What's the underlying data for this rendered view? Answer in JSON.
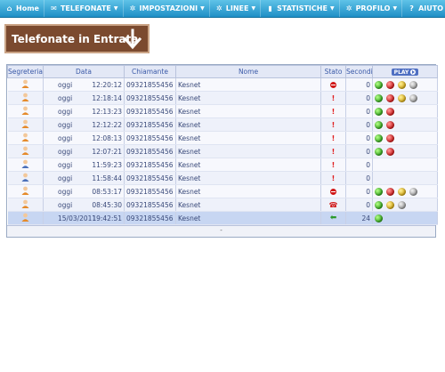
{
  "menu": [
    {
      "label": "Home",
      "icon": "home-icon",
      "glyph": "⌂",
      "has_caret": false
    },
    {
      "label": "TELEFONATE",
      "icon": "chat-icon",
      "glyph": "✉",
      "has_caret": true
    },
    {
      "label": "IMPOSTAZIONI",
      "icon": "gear-icon",
      "glyph": "✲",
      "has_caret": true
    },
    {
      "label": "LINEE",
      "icon": "gear-icon",
      "glyph": "✲",
      "has_caret": true
    },
    {
      "label": "STATISTICHE",
      "icon": "chart-icon",
      "glyph": "▮",
      "has_caret": true
    },
    {
      "label": "PROFILO",
      "icon": "gear-icon",
      "glyph": "✲",
      "has_caret": true
    },
    {
      "label": "AIUTO",
      "icon": "help-icon",
      "glyph": "?",
      "has_caret": true
    }
  ],
  "banner": {
    "title": "Telefonate in Entrata",
    "icon": "down-arrow-icon"
  },
  "table": {
    "headers": {
      "segreteria": "Segreteria",
      "data": "Data",
      "chiamante": "Chiamante",
      "nome": "Nome",
      "stato": "Stato",
      "secondi": "Secondi",
      "play": "PLAY"
    },
    "rows": [
      {
        "day": "oggi",
        "time": "12:20:12",
        "caller": "09321855456",
        "name": "Kesnet",
        "status": "blocked",
        "seconds": "0",
        "lights": [
          "green",
          "red",
          "yellow",
          "grey"
        ],
        "avatar": "orange"
      },
      {
        "day": "oggi",
        "time": "12:18:14",
        "caller": "09321855456",
        "name": "Kesnet",
        "status": "missed",
        "seconds": "0",
        "lights": [
          "green",
          "red",
          "yellow",
          "grey"
        ],
        "avatar": "orange"
      },
      {
        "day": "oggi",
        "time": "12:13:23",
        "caller": "09321855456",
        "name": "Kesnet",
        "status": "missed",
        "seconds": "0",
        "lights": [
          "green",
          "red"
        ],
        "avatar": "orange"
      },
      {
        "day": "oggi",
        "time": "12:12:22",
        "caller": "09321855456",
        "name": "Kesnet",
        "status": "missed",
        "seconds": "0",
        "lights": [
          "green",
          "red"
        ],
        "avatar": "orange"
      },
      {
        "day": "oggi",
        "time": "12:08:13",
        "caller": "09321855456",
        "name": "Kesnet",
        "status": "missed",
        "seconds": "0",
        "lights": [
          "green",
          "red"
        ],
        "avatar": "orange"
      },
      {
        "day": "oggi",
        "time": "12:07:21",
        "caller": "09321855456",
        "name": "Kesnet",
        "status": "missed",
        "seconds": "0",
        "lights": [
          "green",
          "red"
        ],
        "avatar": "orange"
      },
      {
        "day": "oggi",
        "time": "11:59:23",
        "caller": "09321855456",
        "name": "Kesnet",
        "status": "missed",
        "seconds": "0",
        "lights": [],
        "avatar": "blue"
      },
      {
        "day": "oggi",
        "time": "11:58:44",
        "caller": "09321855456",
        "name": "Kesnet",
        "status": "missed",
        "seconds": "0",
        "lights": [],
        "avatar": "blue"
      },
      {
        "day": "oggi",
        "time": "08:53:17",
        "caller": "09321855456",
        "name": "Kesnet",
        "status": "blocked",
        "seconds": "0",
        "lights": [
          "green",
          "red",
          "yellow",
          "grey"
        ],
        "avatar": "orange"
      },
      {
        "day": "oggi",
        "time": "08:45:30",
        "caller": "09321855456",
        "name": "Kesnet",
        "status": "hangup",
        "seconds": "0",
        "lights": [
          "green",
          "yellow",
          "grey"
        ],
        "avatar": "orange"
      },
      {
        "day": "15/03/2011",
        "time": "19:42:51",
        "caller": "09321855456",
        "name": "Kesnet",
        "status": "incoming",
        "seconds": "24",
        "lights": [
          "green"
        ],
        "avatar": "orange"
      }
    ],
    "footer": "-"
  },
  "colors": {
    "menu": "#1f8fc6",
    "banner": "#7b4a2f",
    "header": "#e3e8f6",
    "highlight": "#c7d6f2"
  }
}
